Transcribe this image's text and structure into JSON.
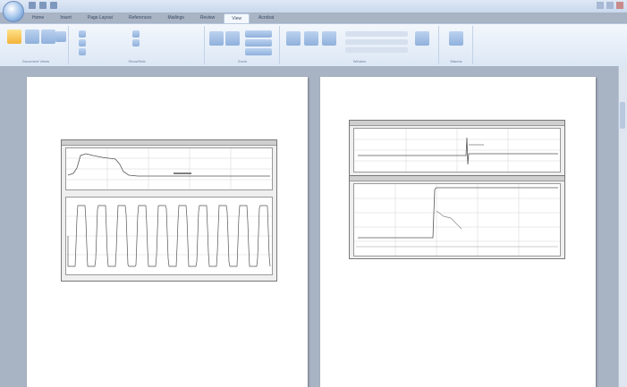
{
  "app": {
    "title": "",
    "tabs": [
      "Home",
      "Insert",
      "Page Layout",
      "References",
      "Mailings",
      "Review",
      "View",
      "Acrobat"
    ],
    "active_tab_index": 6
  },
  "ribbon": {
    "groups": [
      "Document Views",
      "Show/Hide",
      "Zoom",
      "Window",
      "Macros"
    ]
  },
  "page1": {
    "heading": "",
    "legend": [
      {
        "text": "",
        "color": "#c0392b"
      },
      {
        "text": "",
        "color": "#d35400"
      },
      {
        "text": "",
        "color": "#8e44ad"
      },
      {
        "text": "",
        "color": "#27ae60"
      },
      {
        "text": "",
        "color": "#7f8c8d"
      },
      {
        "text": "",
        "color": "#95a5a6"
      }
    ],
    "notes": [
      "",
      "",
      "",
      "",
      ""
    ]
  },
  "page2": {
    "heading": "",
    "legend": [
      {
        "text": "",
        "color": "#2e8b57"
      },
      {
        "text": "",
        "color": "#c0392b"
      },
      {
        "text": "",
        "color": "#d35400"
      },
      {
        "text": "",
        "color": "#8e44ad"
      },
      {
        "text": "",
        "color": "#7f8c8d"
      },
      {
        "text": "",
        "color": "#b8a000"
      },
      {
        "text": "",
        "color": "#27ae60"
      },
      {
        "text": "",
        "color": "#95a5a6"
      },
      {
        "text": "",
        "color": "#c9a400"
      }
    ],
    "notes": [
      "",
      "",
      "",
      ""
    ]
  },
  "colors": {
    "accent": "#dce7f5",
    "page": "#ffffff",
    "background": "#a8b3c3",
    "trace": "#555555"
  }
}
